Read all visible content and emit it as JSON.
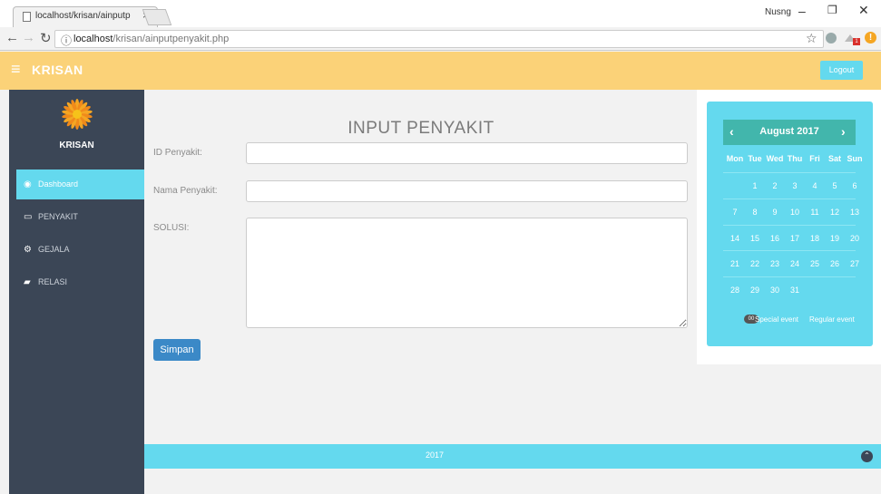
{
  "browser": {
    "tab_title": "localhost/krisan/ainputp",
    "profile_name": "Nusng",
    "url_host": "localhost",
    "url_path": "/krisan/ainputpenyakit.php",
    "ext_badge": "1"
  },
  "header": {
    "brand": "KRISAN",
    "logout_label": "Logout"
  },
  "sidebar": {
    "brand": "KRISAN",
    "items": [
      {
        "label": "Dashboard",
        "icon": "dashboard-icon"
      },
      {
        "label": "PENYAKIT",
        "icon": "monitor-icon"
      },
      {
        "label": "GEJALA",
        "icon": "gears-icon"
      },
      {
        "label": "RELASI",
        "icon": "book-icon"
      }
    ]
  },
  "form": {
    "title": "INPUT PENYAKIT",
    "id_label": "ID Penyakit:",
    "id_value": "",
    "nama_label": "Nama Penyakit:",
    "nama_value": "",
    "solusi_label": "SOLUSI:",
    "solusi_value": "",
    "submit_label": "Simpan"
  },
  "calendar": {
    "month": "August 2017",
    "prev": "‹",
    "next": "›",
    "weekdays": [
      "Mon",
      "Tue",
      "Wed",
      "Thu",
      "Fri",
      "Sat",
      "Sun"
    ],
    "weeks": [
      [
        "",
        "1",
        "2",
        "3",
        "4",
        "5",
        "6"
      ],
      [
        "7",
        "8",
        "9",
        "10",
        "11",
        "12",
        "13"
      ],
      [
        "14",
        "15",
        "16",
        "17",
        "18",
        "19",
        "20"
      ],
      [
        "21",
        "22",
        "23",
        "24",
        "25",
        "26",
        "27"
      ],
      [
        "28",
        "29",
        "30",
        "31",
        "",
        "",
        ""
      ]
    ],
    "legend_badge": "00",
    "legend_special": "Special event",
    "legend_regular": "Regular event"
  },
  "footer": {
    "year": "2017"
  },
  "colors": {
    "header": "#fbd278",
    "sidebar": "#3b4656",
    "accent": "#64d9ee",
    "button": "#3b89c7"
  }
}
